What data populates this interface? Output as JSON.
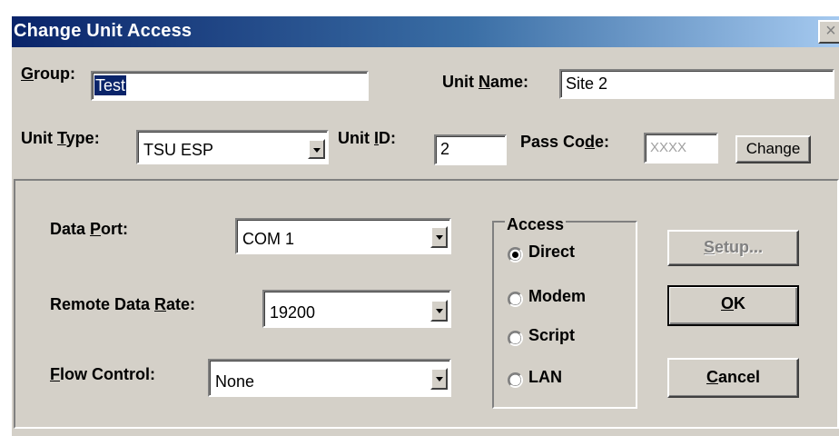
{
  "window": {
    "title": "Change Unit Access",
    "close_glyph": "×"
  },
  "group": {
    "label_accel": "G",
    "label_rest": "roup:",
    "value": "Test"
  },
  "unit_name": {
    "label_pre": "Unit ",
    "label_accel": "N",
    "label_post": "ame:",
    "value": "Site 2"
  },
  "unit_type": {
    "label_pre": "Unit ",
    "label_accel": "T",
    "label_post": "ype:",
    "value": "TSU ESP"
  },
  "unit_id": {
    "label_pre": "Unit ",
    "label_accel": "I",
    "label_post": "D:",
    "value": "2"
  },
  "pass_code": {
    "label_pre": "Pass Co",
    "label_accel": "d",
    "label_post": "e:",
    "value": "XXXX"
  },
  "change_button": {
    "label": "Change"
  },
  "data_port": {
    "label_pre": "Data ",
    "label_accel": "P",
    "label_post": "ort:",
    "value": "COM 1"
  },
  "remote_data_rate": {
    "label_pre": "Remote Data ",
    "label_accel": "R",
    "label_post": "ate:",
    "value": "19200"
  },
  "flow_control": {
    "label_accel": "F",
    "label_rest": "low Control:",
    "value": "None"
  },
  "access": {
    "legend": "Access",
    "options": [
      {
        "label": "Direct",
        "checked": true
      },
      {
        "label": "Modem",
        "checked": false
      },
      {
        "label": "Script",
        "checked": false
      },
      {
        "label": "LAN",
        "checked": false
      }
    ]
  },
  "buttons": {
    "setup": {
      "accel": "S",
      "rest": "etup...",
      "enabled": false
    },
    "ok": {
      "accel": "O",
      "rest": "K"
    },
    "cancel": {
      "accel": "C",
      "rest": "ancel"
    }
  },
  "colors": {
    "titlebar_start": "#0a246a",
    "titlebar_end": "#a6caf0",
    "face": "#d4d0c8",
    "selection": "#0a246a"
  }
}
